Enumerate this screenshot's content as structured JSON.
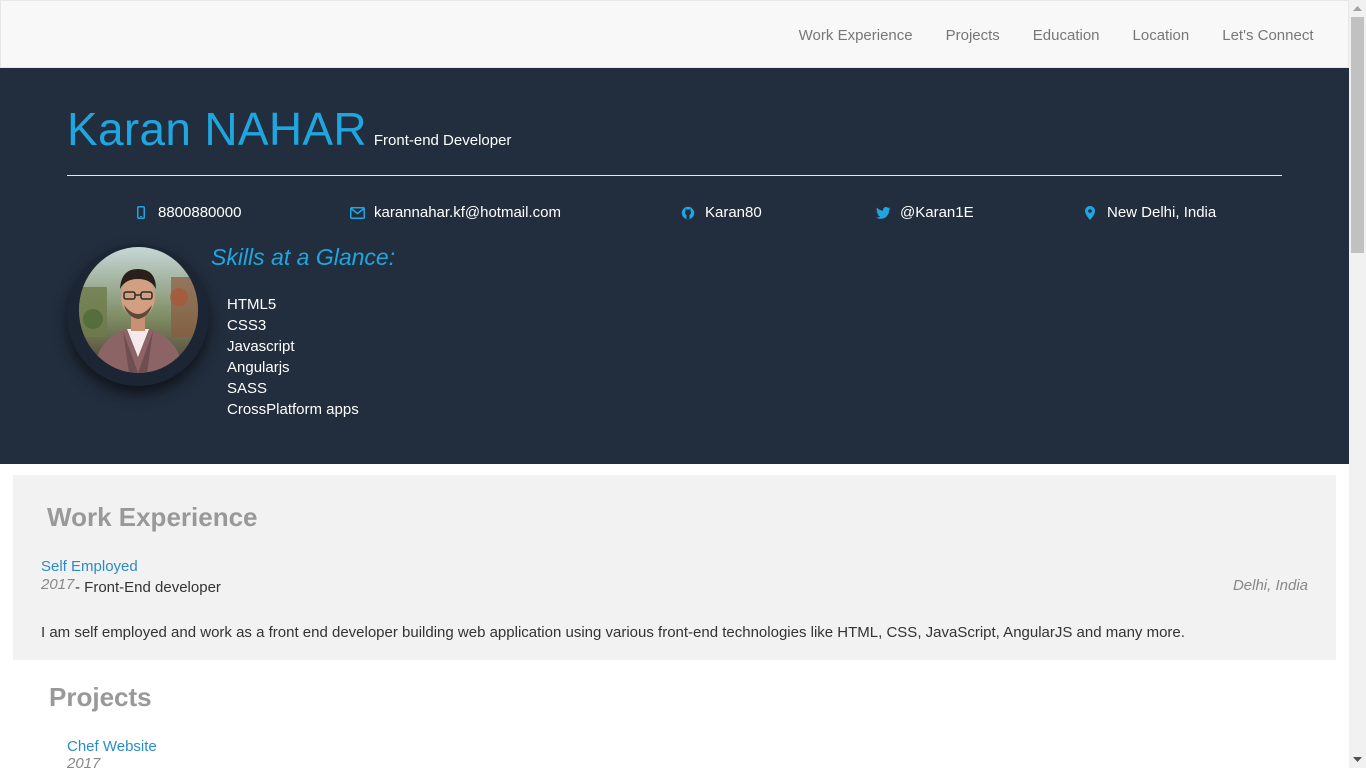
{
  "nav": {
    "items": [
      {
        "label": "Work Experience"
      },
      {
        "label": "Projects"
      },
      {
        "label": "Education"
      },
      {
        "label": "Location"
      },
      {
        "label": "Let's Connect"
      }
    ]
  },
  "header": {
    "name": "Karan NAHAR",
    "role": "Front-end Developer",
    "contacts": {
      "phone": "8800880000",
      "email": "karannahar.kf@hotmail.com",
      "github": "Karan80",
      "twitter": "@Karan1E",
      "location": "New Delhi, India"
    },
    "contact_icons": [
      "mobile-icon",
      "envelope-icon",
      "github-icon",
      "twitter-icon",
      "map-marker-icon"
    ],
    "skills_title": "Skills at a Glance:",
    "skills": [
      "HTML5",
      "CSS3",
      "Javascript",
      "Angularjs",
      "SASS",
      "CrossPlatform apps"
    ]
  },
  "work": {
    "title": "Work Experience",
    "jobs": [
      {
        "company": "Self Employed",
        "year": "2017",
        "title": "- Front-End developer",
        "location": "Delhi, India",
        "description": "I am self employed and work as a front end developer building web application using various front-end technologies like HTML, CSS, JavaScript, AngularJS and many more."
      }
    ]
  },
  "projects": {
    "title": "Projects",
    "items": [
      {
        "name": "Chef Website",
        "year": "2017"
      }
    ]
  },
  "colors": {
    "accent": "#1fa6e0",
    "header_bg": "#222d3d",
    "link": "#2b8cc4",
    "section_bg": "#f2f2f2"
  }
}
